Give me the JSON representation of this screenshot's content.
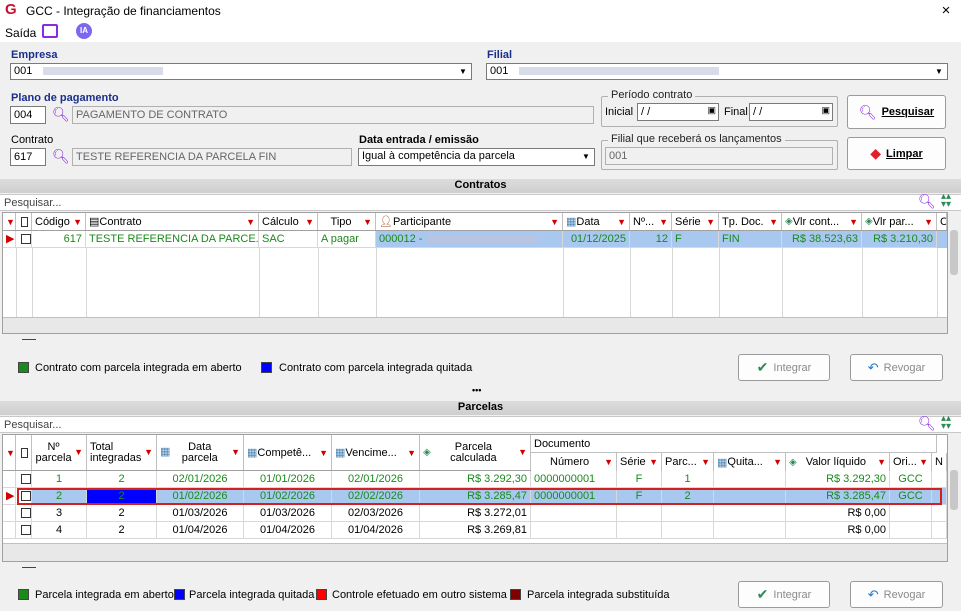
{
  "window": {
    "title": "GCC - Integração de financiamentos",
    "close": "×"
  },
  "menu": {
    "saida": "Saída",
    "ia": "IA"
  },
  "form": {
    "empresa_label": "Empresa",
    "empresa_value": "001",
    "filial_label": "Filial",
    "filial_value": "001",
    "plano_label": "Plano de pagamento",
    "plano_code": "004",
    "plano_desc": "PAGAMENTO DE CONTRATO",
    "periodo_label": "Período contrato",
    "inicial_label": "Inicial",
    "inicial_value": " / /",
    "final_label": "Final",
    "final_value": " / /",
    "pesquisar": "Pesquisar",
    "contrato_label": "Contrato",
    "contrato_code": "617",
    "contrato_desc": "TESTE REFERENCIA DA PARCELA FIN",
    "data_label": "Data entrada / emissão",
    "data_value": "Igual à competência da parcela",
    "filial_lanc_label": "Filial que receberá os lançamentos",
    "filial_lanc_value": "001",
    "limpar": "Limpar"
  },
  "contratos": {
    "title": "Contratos",
    "search": "Pesquisar...",
    "headers": [
      "Código",
      "Contrato",
      "Cálculo",
      "Tipo",
      "Participante",
      "Data",
      "Nº...",
      "Série",
      "Tp. Doc.",
      "Vlr cont...",
      "Vlr par...",
      "C"
    ],
    "row": {
      "codigo": "617",
      "contrato": "TESTE REFERENCIA DA PARCE...",
      "calculo": "SAC",
      "tipo": "A pagar",
      "participante": "000012 -",
      "data": "01/12/2025",
      "num": "12",
      "serie": "F",
      "tpdoc": "FIN",
      "vlrcont": "R$ 38.523,63",
      "vlrpar": "R$ 3.210,30"
    }
  },
  "legend1": {
    "aberto": "Contrato com parcela integrada em aberto",
    "quitada": "Contrato com parcela integrada quitada"
  },
  "actions": {
    "integrar": "Integrar",
    "revogar": "Revogar"
  },
  "dots": "•••",
  "parcelas": {
    "title": "Parcelas",
    "search": "Pesquisar...",
    "headers": {
      "num": "Nº parcela",
      "total": "Total integradas",
      "data": "Data parcela",
      "compet": "Competê...",
      "venc": "Vencime...",
      "calc": "Parcela calculada",
      "documento": "Documento",
      "numero": "Número",
      "serie": "Série",
      "parc": "Parc...",
      "quita": "Quita...",
      "liquido": "Valor líquido",
      "ori": "Ori...",
      "n": "N"
    },
    "rows": [
      {
        "num": "1",
        "total": "2",
        "data": "02/01/2026",
        "compet": "01/01/2026",
        "venc": "02/01/2026",
        "calc": "R$ 3.292,30",
        "numero": "0000000001",
        "serie": "F",
        "parc": "1",
        "liquido": "R$ 3.292,30",
        "ori": "GCC"
      },
      {
        "num": "2",
        "total": "2",
        "data": "01/02/2026",
        "compet": "01/02/2026",
        "venc": "02/02/2026",
        "calc": "R$ 3.285,47",
        "numero": "0000000001",
        "serie": "F",
        "parc": "2",
        "liquido": "R$ 3.285,47",
        "ori": "GCC"
      },
      {
        "num": "3",
        "total": "2",
        "data": "01/03/2026",
        "compet": "01/03/2026",
        "venc": "02/03/2026",
        "calc": "R$ 3.272,01",
        "numero": "",
        "serie": "",
        "parc": "",
        "liquido": "R$ 0,00",
        "ori": ""
      },
      {
        "num": "4",
        "total": "2",
        "data": "01/04/2026",
        "compet": "01/04/2026",
        "venc": "01/04/2026",
        "calc": "R$ 3.269,81",
        "numero": "",
        "serie": "",
        "parc": "",
        "liquido": "R$ 0,00",
        "ori": ""
      }
    ]
  },
  "legend2": {
    "aberto": "Parcela integrada em aberto",
    "quitada": "Parcela integrada quitada",
    "controle": "Controle efetuado em outro sistema",
    "substituida": "Parcela integrada substituída"
  },
  "colors": {
    "green": "#1a8a1a",
    "blue": "#0000ff",
    "red": "#ff0000",
    "maroon": "#800000",
    "selected": "#a8c8f0",
    "accent": "#8a2be2"
  }
}
